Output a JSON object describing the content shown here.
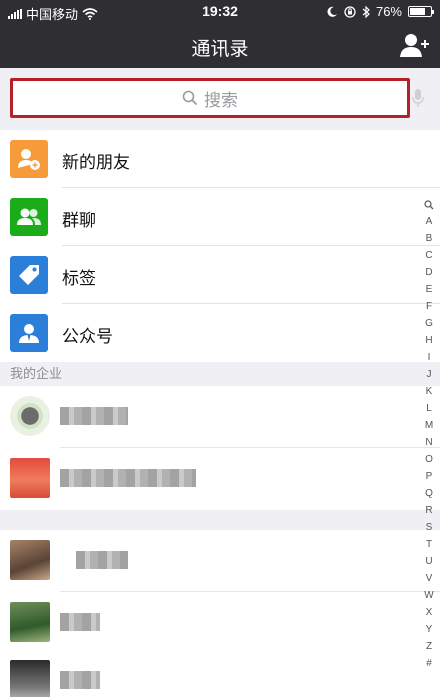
{
  "status_bar": {
    "carrier": "中国移动",
    "time": "19:32",
    "battery": "76%",
    "battery_level": 0.76
  },
  "nav": {
    "title": "通讯录",
    "add_icon": "add-contact-icon"
  },
  "search": {
    "placeholder": "搜索",
    "icon": "search-icon",
    "mic_icon": "mic-icon",
    "highlight_color": "#b5202a"
  },
  "functions": [
    {
      "label": "新的朋友",
      "icon": "new-friends-icon",
      "color": "#f79a3a"
    },
    {
      "label": "群聊",
      "icon": "group-chat-icon",
      "color": "#1aad19"
    },
    {
      "label": "标签",
      "icon": "tag-icon",
      "color": "#2c7fd8"
    },
    {
      "label": "公众号",
      "icon": "official-account-icon",
      "color": "#2c7fd8"
    }
  ],
  "sections": {
    "enterprise": "我的企业"
  },
  "index_letters": [
    "A",
    "B",
    "C",
    "D",
    "E",
    "F",
    "G",
    "H",
    "I",
    "J",
    "K",
    "L",
    "M",
    "N",
    "O",
    "P",
    "Q",
    "R",
    "S",
    "T",
    "U",
    "V",
    "W",
    "X",
    "Y",
    "Z",
    "#"
  ],
  "colors": {
    "navbar": "#2f2f33",
    "background": "#efeff4",
    "wechat_green": "#1aad19"
  }
}
